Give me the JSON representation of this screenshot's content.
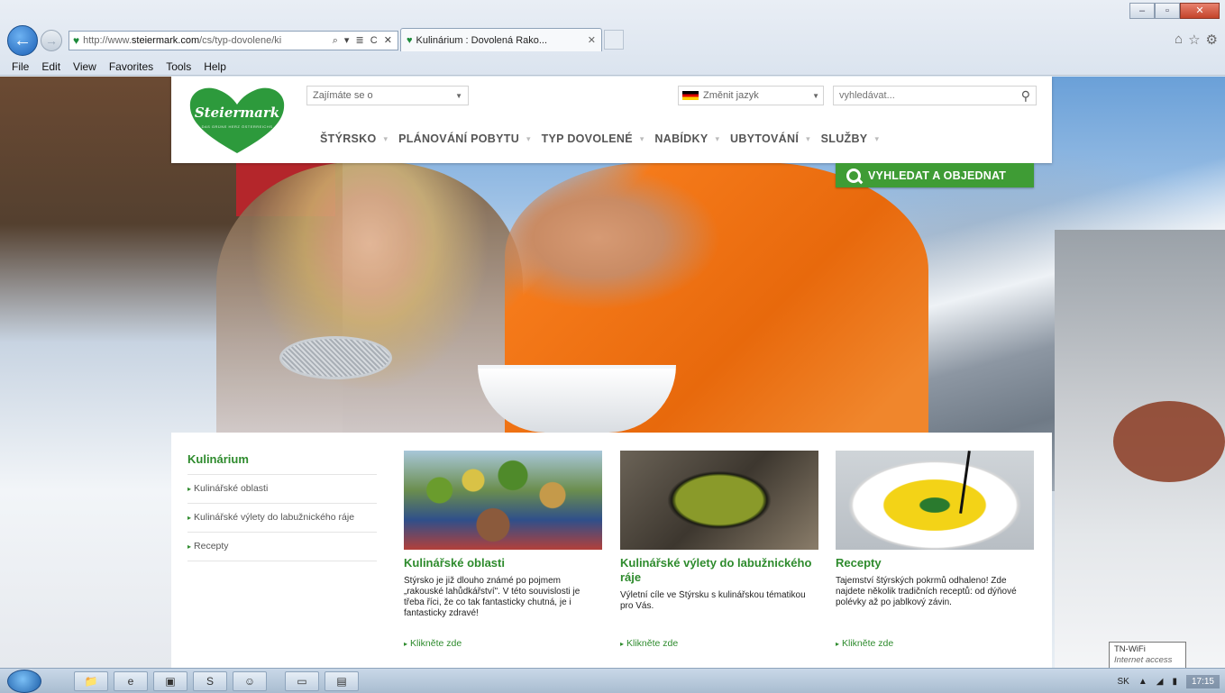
{
  "browser": {
    "address": {
      "prefix": "http://www.",
      "domain": "steiermark.com",
      "path": "/cs/typ-dovolene/ki",
      "controls": "⌕ ▾ ≣ C ✕"
    },
    "tab_title": "Kulinárium : Dovolená Rako...",
    "menu": [
      "File",
      "Edit",
      "View",
      "Favorites",
      "Tools",
      "Help"
    ]
  },
  "header": {
    "logo_text": "Steiermark",
    "logo_sub": "DAS GRÜNE HERZ ÖSTERREICHS",
    "interest_label": "Zajímáte se o",
    "language_label": "Změnit jazyk",
    "search_placeholder": "vyhledávat...",
    "nav": [
      "ŠTÝRSKO",
      "PLÁNOVÁNÍ POBYTU",
      "TYP DOVOLENÉ",
      "NABÍDKY",
      "UBYTOVÁNÍ",
      "SLUŽBY"
    ],
    "book_button": "VYHLEDAT A OBJEDNAT"
  },
  "sidebar": {
    "title": "Kulinárium",
    "links": [
      "Kulinářské oblasti",
      "Kulinářské výlety do labužnického ráje",
      "Recepty"
    ]
  },
  "cards": [
    {
      "title": "Kulinářské oblasti",
      "text": "Štýrsko je již dlouho známé po pojmem „rakouské lahůdkářství\". V této souvislosti je třeba říci, že co tak fantasticky chutná, je i fantasticky zdravé!",
      "link": "Klikněte zde"
    },
    {
      "title": "Kulinářské výlety do labužnického ráje",
      "text": "Výletní cíle ve Štýrsku s kulinářskou tématikou pro Vás.",
      "link": "Klikněte zde"
    },
    {
      "title": "Recepty",
      "text": "Tajemství štýrských pokrmů odhaleno! Zde najdete několik tradičních receptů: od dýňové polévky až po jablkový závin.",
      "link": "Klikněte zde"
    }
  ],
  "taskbar": {
    "tooltip_title": "TN-WiFi",
    "tooltip_sub": "Internet access",
    "lang": "SK",
    "time": "17:15"
  },
  "colors": {
    "brand_green": "#2e8b2d",
    "button_green": "#3f9c35",
    "jacket_orange": "#f57a1a"
  }
}
